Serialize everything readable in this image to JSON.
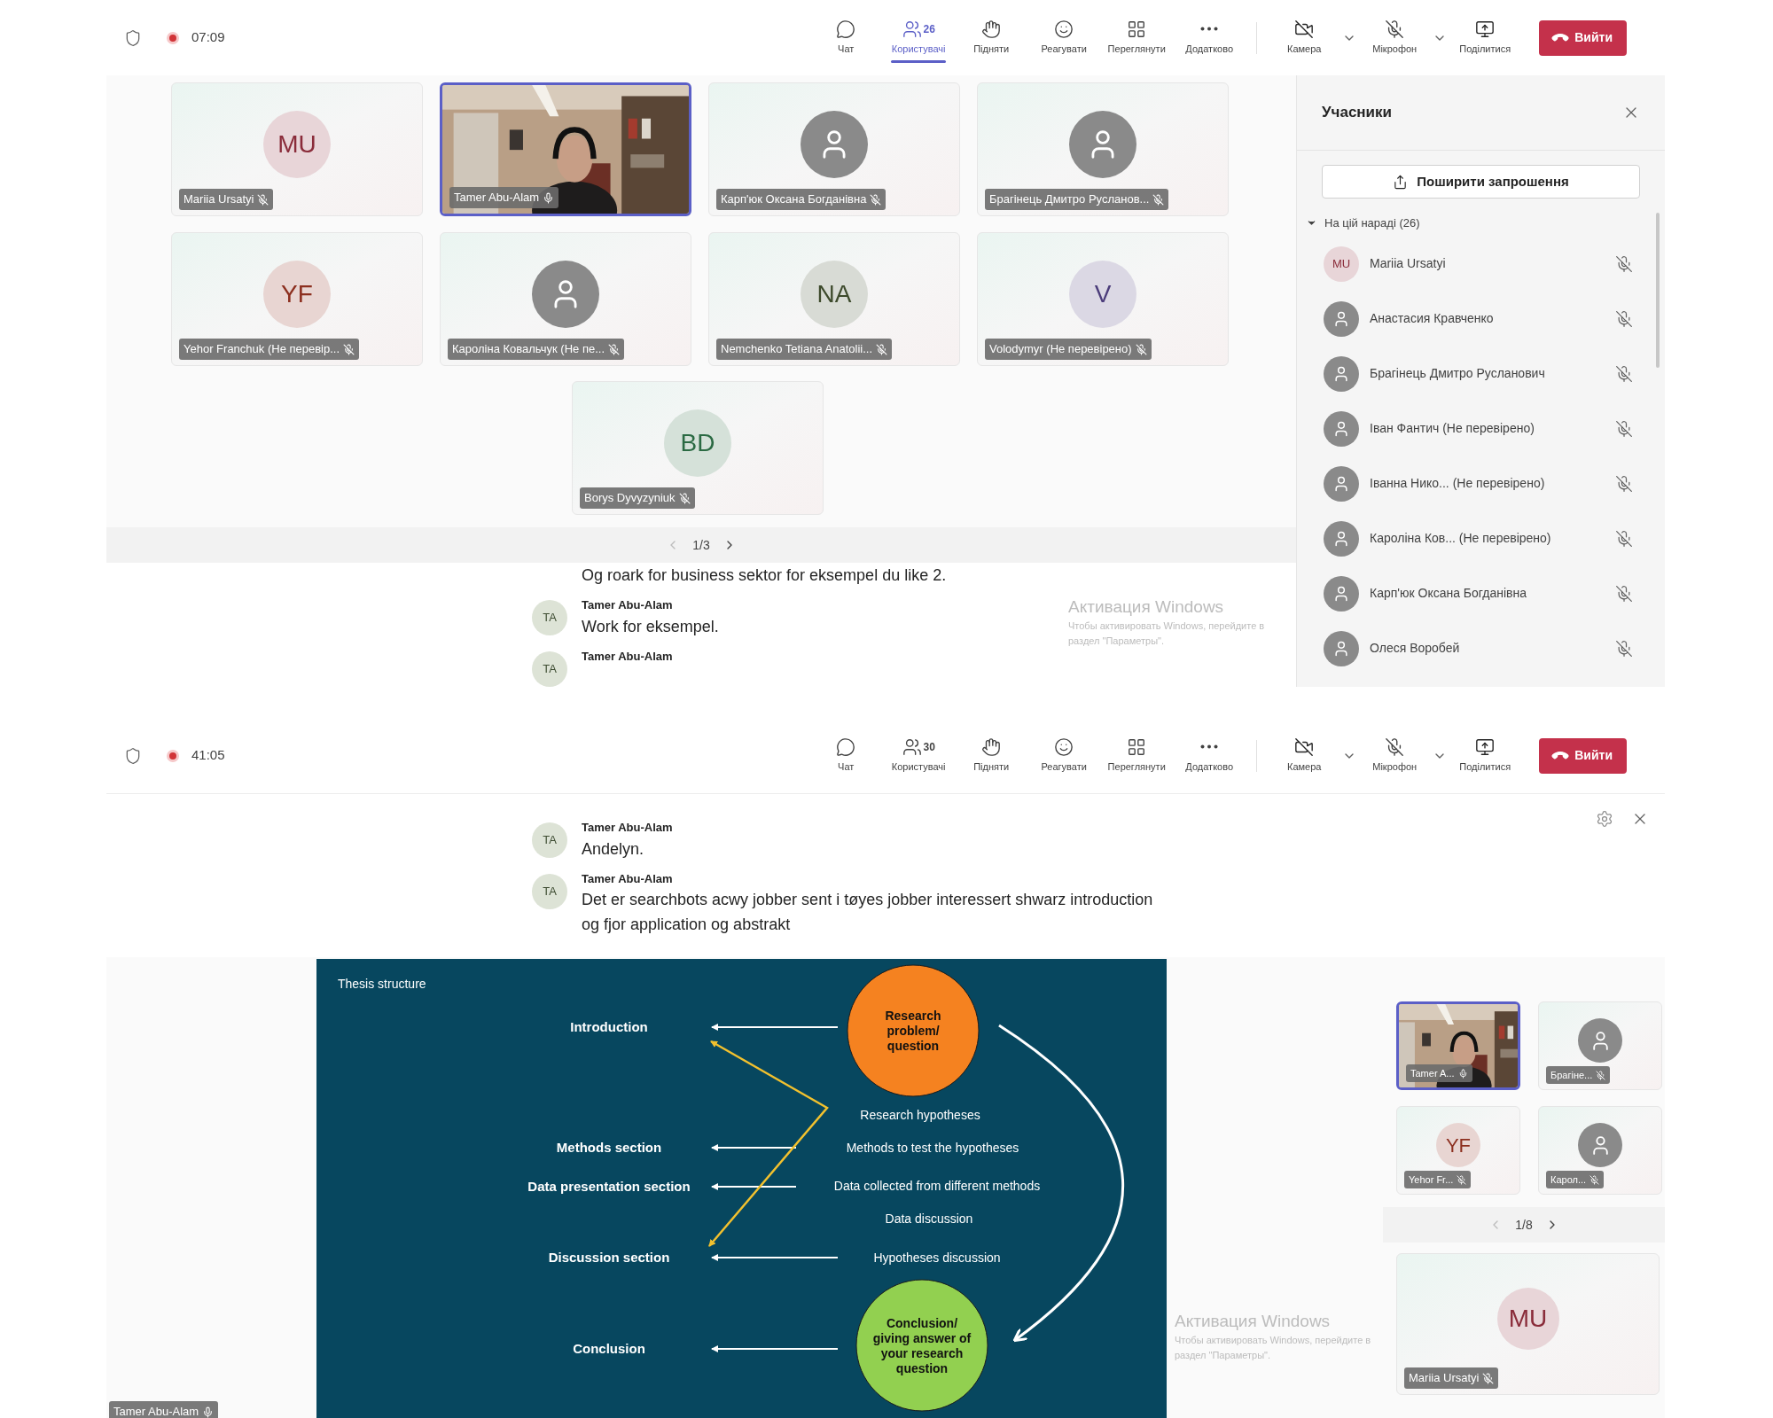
{
  "gallery_screen": {
    "toolbar": {
      "time": "07:09",
      "recording": true,
      "items": [
        {
          "kind": "chat",
          "label": "Чат",
          "selected": false
        },
        {
          "kind": "people",
          "label": "Користувачі",
          "count": "26",
          "selected": true
        },
        {
          "kind": "raise",
          "label": "Підняти",
          "selected": false
        },
        {
          "kind": "react",
          "label": "Реагувати",
          "selected": false
        },
        {
          "kind": "view",
          "label": "Переглянути",
          "selected": false
        },
        {
          "kind": "more",
          "label": "Додатково",
          "selected": false
        },
        {
          "kind": "camera",
          "label": "Камера",
          "selected": false
        },
        {
          "kind": "mic",
          "label": "Мікрофон",
          "selected": false
        },
        {
          "kind": "share",
          "label": "Поділитися",
          "selected": false
        }
      ],
      "leave": "Вийти"
    },
    "tiles": [
      {
        "kind": "initials",
        "name": "Mariia Ursatyi",
        "initials": "MU",
        "color": "#8a2c3a",
        "muted": true,
        "highlighted": false
      },
      {
        "kind": "video",
        "name": "Tamer Abu-Alam",
        "muted": false,
        "highlighted": true
      },
      {
        "kind": "avatar",
        "name": "Карп'юк Оксана Богданівна",
        "muted": true,
        "highlighted": false
      },
      {
        "kind": "avatar",
        "name": "Брагінець Дмитро Русланов...",
        "muted": true,
        "highlighted": false
      },
      {
        "kind": "initials",
        "name": "Yehor Franchuk (Не перевір...",
        "initials": "YF",
        "color": "#8c2f1f",
        "muted": true,
        "highlighted": false
      },
      {
        "kind": "avatar",
        "name": "Кароліна Ковальчук (Не пе...",
        "muted": true,
        "highlighted": false
      },
      {
        "kind": "initials",
        "name": "Nemchenko Tetiana Anatolii...",
        "initials": "NA",
        "color": "#3d4a2c",
        "muted": true,
        "highlighted": false
      },
      {
        "kind": "initials",
        "name": "Volodymyr (Не перевірено)",
        "initials": "V",
        "color": "#4b3c7a",
        "muted": true,
        "highlighted": false
      },
      {
        "kind": "initials",
        "name": "Borys Dyvyzyniuk",
        "initials": "BD",
        "color": "#2b6a43",
        "muted": true,
        "highlighted": false
      }
    ],
    "pager": "1/3",
    "chat": [
      {
        "text": "Og roark for business sektor for eksempel du like 2."
      },
      {
        "avatar": "TA",
        "author": "Tamer Abu-Alam",
        "text": "Work for eksempel."
      },
      {
        "avatar": "TA",
        "author": "Tamer Abu-Alam"
      }
    ],
    "panel": {
      "title": "Учасники",
      "invite": "Поширити запрошення",
      "section": {
        "label": "На цій нараді (26)",
        "expanded": true
      },
      "people": [
        {
          "name": "Mariia Ursatyi",
          "initials": "MU",
          "color": "#8a2c3a",
          "muted": true
        },
        {
          "name": "Анастасия Кравченко",
          "muted": true
        },
        {
          "name": "Брагінець Дмитро Русланович",
          "muted": true
        },
        {
          "name": "Іван Фантич (Не перевірено)",
          "muted": true
        },
        {
          "name": "Іванна Нико...  (Не перевірено)",
          "muted": true
        },
        {
          "name": "Кароліна Ков... (Не перевірено)",
          "muted": true
        },
        {
          "name": "Карп'юк Оксана Богданівна",
          "muted": true
        },
        {
          "name": "Олеся Воробей",
          "muted": true
        }
      ]
    },
    "activation": {
      "title": "Активация Windows",
      "lines": [
        "Чтобы активировать Windows, перейдите в",
        "раздел \"Параметры\"."
      ]
    }
  },
  "presentation_screen": {
    "toolbar": {
      "time": "41:05",
      "recording": true,
      "items": [
        {
          "kind": "chat",
          "label": "Чат",
          "selected": false
        },
        {
          "kind": "people",
          "label": "Користувачі",
          "count": "30",
          "selected": false
        },
        {
          "kind": "raise",
          "label": "Підняти",
          "selected": false
        },
        {
          "kind": "react",
          "label": "Реагувати",
          "selected": false
        },
        {
          "kind": "view",
          "label": "Переглянути",
          "selected": false
        },
        {
          "kind": "more",
          "label": "Додатково",
          "selected": false
        },
        {
          "kind": "camera",
          "label": "Камера",
          "selected": false
        },
        {
          "kind": "mic",
          "label": "Мікрофон",
          "selected": false
        },
        {
          "kind": "share",
          "label": "Поділитися",
          "selected": false
        }
      ],
      "leave": "Вийти"
    },
    "chat": [
      {
        "avatar": "TA",
        "author": "Tamer Abu-Alam",
        "text": "Andelyn."
      },
      {
        "avatar": "TA",
        "author": "Tamer Abu-Alam",
        "text": "Det er searchbots acwy jobber sent i tøyes jobber interessert shwarz introduction og fjor application og abstrakt"
      }
    ],
    "slide": {
      "title": "Thesis structure",
      "sections": [
        "Introduction",
        "Methods section",
        "Data presentation section",
        "Discussion section",
        "Conclusion"
      ],
      "notes": [
        "Research hypotheses",
        "Methods to test the hypotheses",
        "Data collected from different methods",
        "Data discussion",
        "Hypotheses discussion"
      ],
      "bubbles": [
        {
          "lines": [
            "Research",
            "problem/",
            "question"
          ],
          "color": "#f58220"
        },
        {
          "lines": [
            "Conclusion/",
            "giving answer of",
            "your research",
            "question"
          ],
          "color": "#92d050"
        }
      ]
    },
    "presenter": {
      "name": "Tamer Abu-Alam",
      "muted": false
    },
    "side_tiles": [
      {
        "kind": "video",
        "name": "Tamer A...",
        "muted": false,
        "highlighted": true
      },
      {
        "kind": "avatar",
        "name": "Брагіне...",
        "muted": true,
        "highlighted": false
      },
      {
        "kind": "initials",
        "name": "Yehor Fr...",
        "initials": "YF",
        "color": "#8c2f1f",
        "muted": true,
        "highlighted": false
      },
      {
        "kind": "avatar",
        "name": "Карол...",
        "muted": true,
        "highlighted": false
      }
    ],
    "pager": "1/8",
    "featured": {
      "kind": "initials",
      "name": "Mariia Ursatyi",
      "initials": "MU",
      "color": "#8a2c3a",
      "muted": true,
      "highlighted": false
    },
    "activation": {
      "title": "Активация Windows",
      "lines": [
        "Чтобы активировать Windows, перейдите в",
        "раздел \"Параметры\"."
      ]
    }
  }
}
